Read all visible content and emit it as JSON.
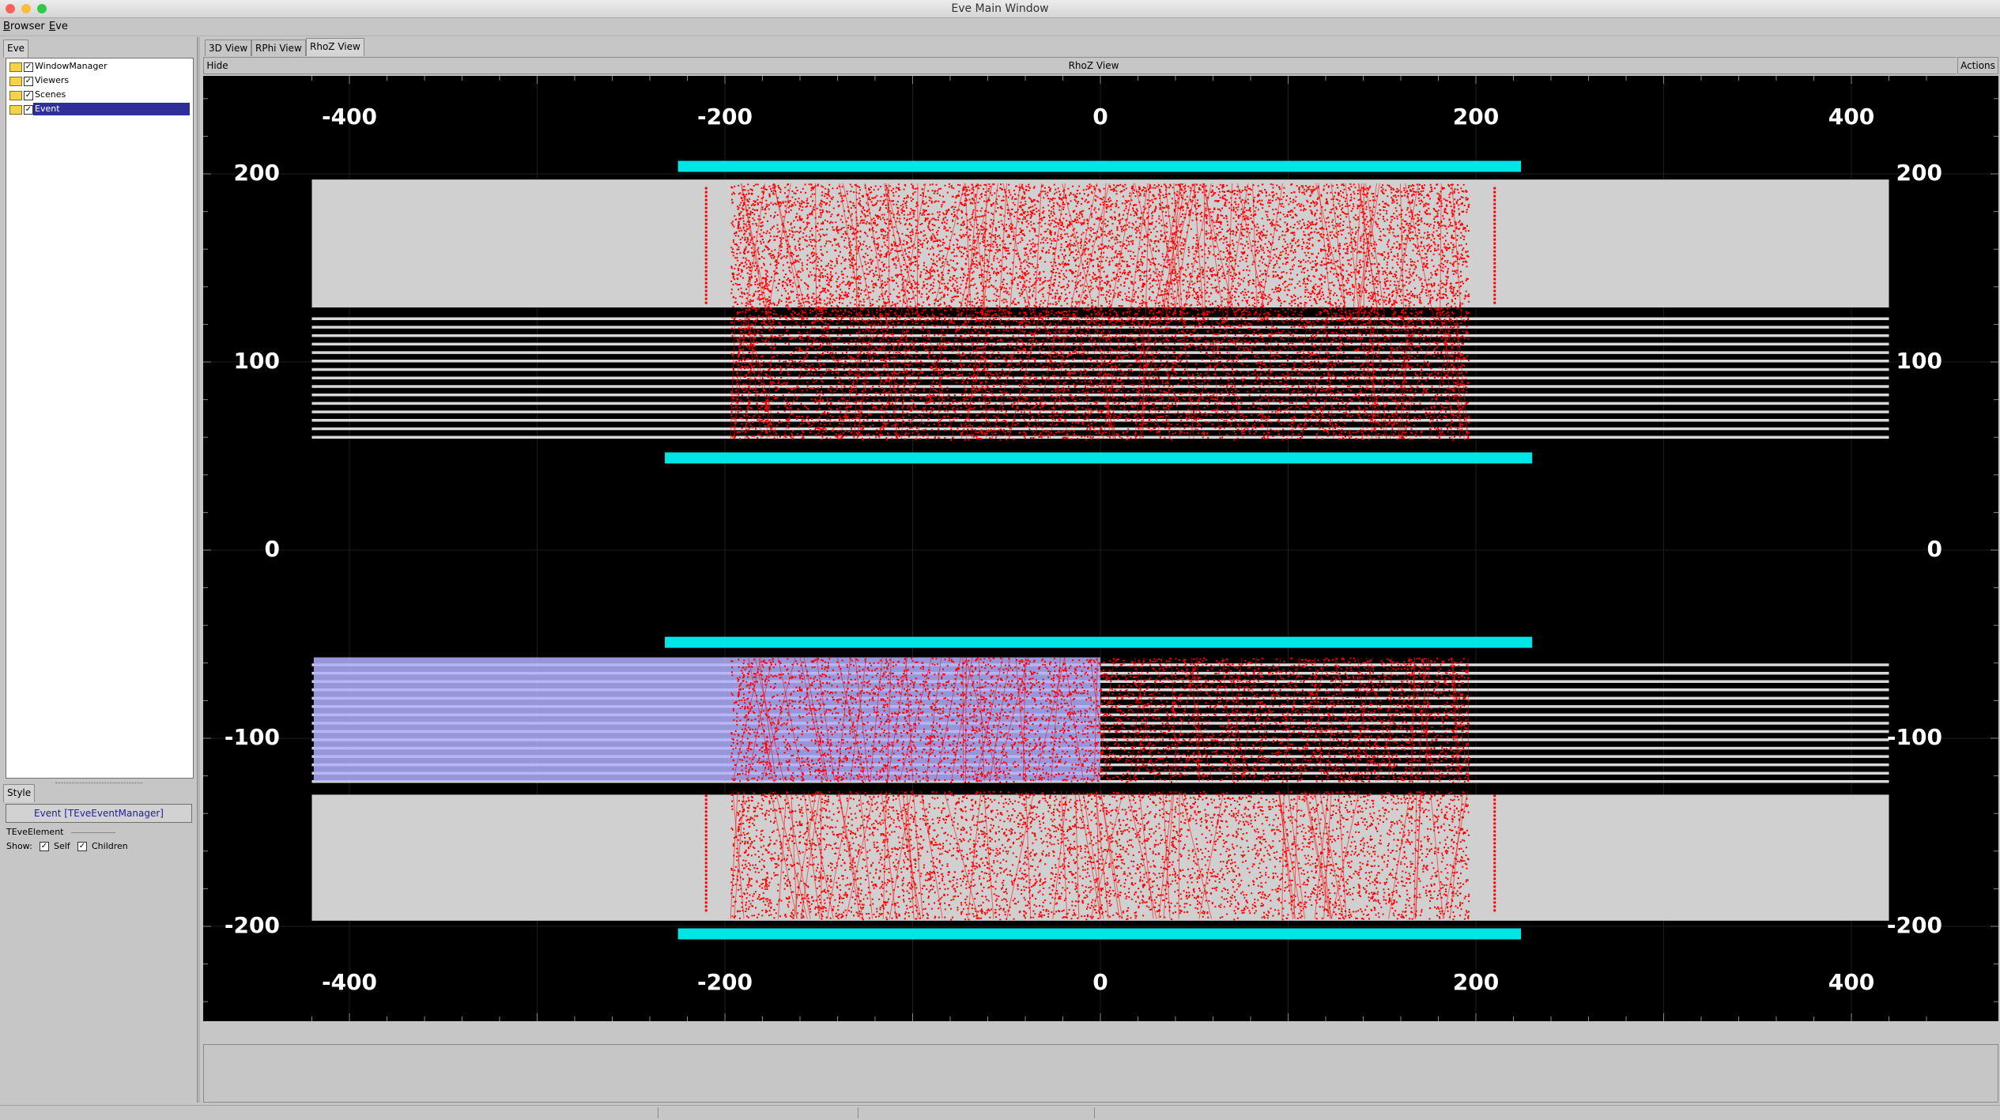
{
  "window": {
    "title": "Eve Main Window"
  },
  "menubar": {
    "items": [
      "Browser",
      "Eve"
    ]
  },
  "left_panel": {
    "tab": "Eve",
    "tree": [
      {
        "label": "WindowManager",
        "checked": true,
        "selected": false
      },
      {
        "label": "Viewers",
        "checked": true,
        "selected": false
      },
      {
        "label": "Scenes",
        "checked": true,
        "selected": false
      },
      {
        "label": "Event",
        "checked": true,
        "selected": true
      }
    ],
    "style_tab": "Style",
    "element_button": "Event [TEveEventManager]",
    "element_class": "TEveElement",
    "show_label": "Show:",
    "self_label": "Self",
    "children_label": "Children",
    "self_checked": true,
    "children_checked": true
  },
  "view_tabs": [
    "3D View",
    "RPhi View",
    "RhoZ View"
  ],
  "active_view_tab": "RhoZ View",
  "view_header": {
    "hide_label": "Hide",
    "title": "RhoZ View",
    "actions_label": "Actions"
  },
  "chart_data": {
    "type": "scatter",
    "x_ticks": [
      -400,
      -200,
      0,
      200,
      400
    ],
    "y_ticks": [
      200,
      100,
      0,
      -100,
      -200
    ],
    "xlim": [
      -435,
      450
    ],
    "ylim": [
      -250,
      240
    ],
    "colors": {
      "background": "#000000",
      "hits": "#ff0000",
      "calorimeter": "#d0d0d0",
      "strips": "#d8d8d8",
      "boundary": "#00e5e5",
      "selected_overlay": "#b0b0ff",
      "tick_labels": "#ffffff"
    },
    "boundary_bars": [
      {
        "x": [
          -225,
          224
        ],
        "y": 204
      },
      {
        "x": [
          -232,
          230
        ],
        "y": 49
      },
      {
        "x": [
          -232,
          230
        ],
        "y": -49
      },
      {
        "x": [
          -225,
          224
        ],
        "y": -204
      }
    ],
    "gray_blocks": [
      {
        "x": [
          -420,
          420
        ],
        "y": [
          129,
          197
        ]
      },
      {
        "x": [
          -420,
          420
        ],
        "y": [
          -197,
          -130
        ]
      }
    ],
    "strip_layers": {
      "top": {
        "x": [
          -420,
          420
        ],
        "y_from": 60,
        "y_to": 123,
        "count": 15
      },
      "bottom": {
        "x": [
          -420,
          420
        ],
        "y_from": -123,
        "y_to": -61,
        "count": 15
      }
    },
    "hit_regions": [
      {
        "x": [
          -197,
          196
        ],
        "y": [
          122,
          195
        ]
      },
      {
        "x": [
          -197,
          196
        ],
        "y": [
          59,
          123
        ]
      },
      {
        "x": [
          -197,
          196
        ],
        "y": [
          -123,
          -57
        ]
      },
      {
        "x": [
          -197,
          196
        ],
        "y": [
          -196,
          -128
        ]
      }
    ],
    "endcap_hit_lines": [
      {
        "x": -210,
        "y": [
          130,
          193
        ]
      },
      {
        "x": 210,
        "y": [
          130,
          193
        ]
      },
      {
        "x": -210,
        "y": [
          -193,
          -130
        ]
      },
      {
        "x": 210,
        "y": [
          -193,
          -130
        ]
      }
    ],
    "selection_overlay": {
      "x": [
        -419,
        0
      ],
      "y": [
        -123,
        -57
      ]
    }
  }
}
